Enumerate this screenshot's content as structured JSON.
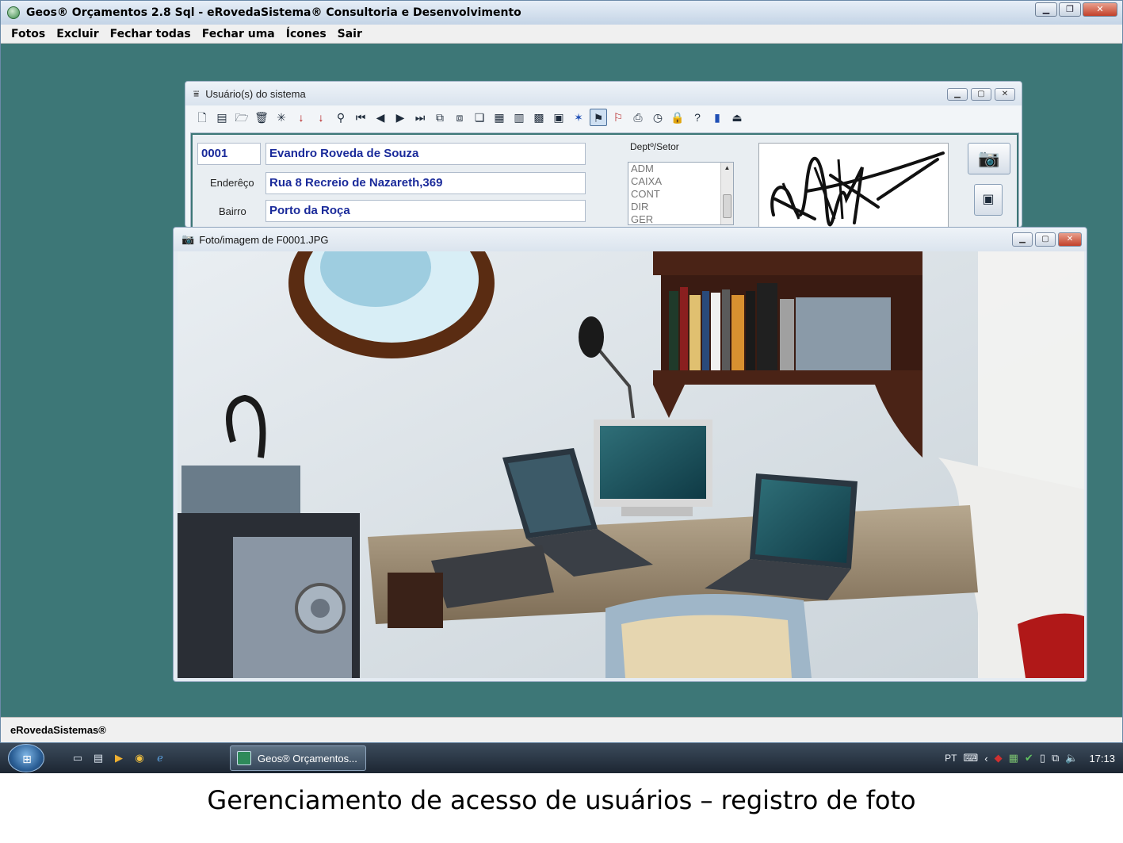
{
  "app": {
    "title": "Geos® Orçamentos 2.8 Sql - eRovedaSistema® Consultoria e Desenvolvimento",
    "menu": [
      "Fotos",
      "Excluir",
      "Fechar todas",
      "Fechar uma",
      "Ícones",
      "Sair"
    ],
    "status": "eRovedaSistemas®"
  },
  "users_window": {
    "title": "Usuário(s) do sistema",
    "code": "0001",
    "name": "Evandro Roveda de Souza",
    "address_label": "Enderêço",
    "address": "Rua 8 Recreio de Nazareth,369",
    "district_label": "Bairro",
    "district": "Porto da Roça",
    "dept_label": "Deptº/Setor",
    "departments": [
      "ADM",
      "CAIXA",
      "CONT",
      "DIR",
      "GER"
    ]
  },
  "photo_window": {
    "title": "Foto/imagem de F0001.JPG"
  },
  "taskbar": {
    "task_label": "Geos® Orçamentos...",
    "language": "PT",
    "clock": "17:13"
  },
  "caption": "Gerenciamento de acesso de usuários – registro de foto",
  "colors": {
    "desktop_bg": "#3d7777",
    "field_text": "#1a2a9a"
  }
}
